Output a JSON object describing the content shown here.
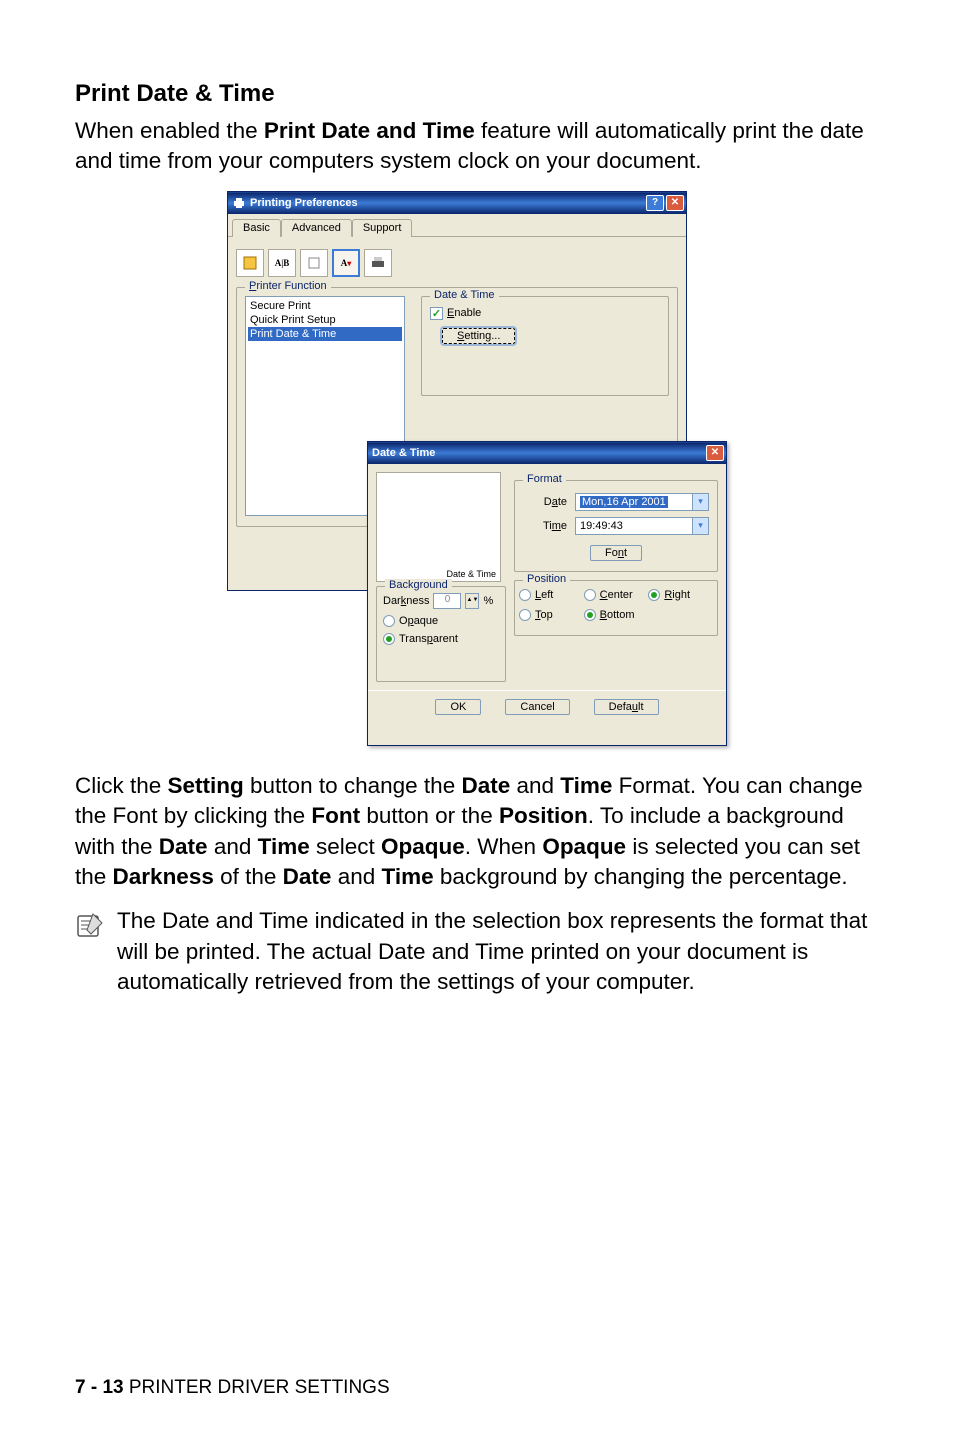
{
  "doc": {
    "heading": "Print Date & Time",
    "intro_parts": [
      "When enabled the ",
      "Print Date and Time",
      " feature will automatically print the date and time from your computers system clock on your document."
    ],
    "para2_runs": [
      {
        "t": "Click the "
      },
      {
        "t": "Setting",
        "b": true
      },
      {
        "t": " button to change the "
      },
      {
        "t": "Date",
        "b": true
      },
      {
        "t": " and "
      },
      {
        "t": "Time",
        "b": true
      },
      {
        "t": " Format. You can change the Font by clicking the "
      },
      {
        "t": "Font",
        "b": true
      },
      {
        "t": " button or the "
      },
      {
        "t": "Position",
        "b": true
      },
      {
        "t": ". To include a background with the "
      },
      {
        "t": "Date",
        "b": true
      },
      {
        "t": " and "
      },
      {
        "t": "Time",
        "b": true
      },
      {
        "t": " select "
      },
      {
        "t": "Opaque",
        "b": true
      },
      {
        "t": ". When "
      },
      {
        "t": "Opaque",
        "b": true
      },
      {
        "t": " is selected you can set the "
      },
      {
        "t": "Darkness",
        "b": true
      },
      {
        "t": " of the "
      },
      {
        "t": "Date",
        "b": true
      },
      {
        "t": " and "
      },
      {
        "t": "Time",
        "b": true
      },
      {
        "t": " background by changing the percentage."
      }
    ],
    "note": "The Date and Time indicated in the selection box represents the format that will be printed. The actual Date and Time printed on your document is automatically retrieved from the settings of your computer.",
    "footer_page": "7 - 13",
    "footer_title": "   PRINTER DRIVER SETTINGS"
  },
  "win": {
    "title": "Printing Preferences",
    "tabs": {
      "basic": "Basic",
      "advanced": "Advanced",
      "support": "Support"
    },
    "groupbox_title": "Printer Function",
    "func_items": [
      "Secure Print",
      "Quick Print Setup",
      "Print Date & Time"
    ],
    "func_selected_index": 2,
    "dt_group_title": "Date & Time",
    "enable_text": "Enable",
    "setting_btn": "Setting..."
  },
  "sub": {
    "title": "Date & Time",
    "preview_label": "Date & Time",
    "bg_group_title": "Background",
    "darkness_label": "Darkness",
    "darkness_value": "0",
    "darkness_unit": "%",
    "opaque_label": "Opaque",
    "transparent_label": "Transparent",
    "format_group_title": "Format",
    "date_label": "Date",
    "date_value": "Mon,16 Apr 2001",
    "time_label": "Time",
    "time_value": "19:49:43",
    "font_btn": "Font",
    "position_group_title": "Position",
    "pos_left": "Left",
    "pos_center": "Center",
    "pos_right": "Right",
    "pos_top": "Top",
    "pos_bottom": "Bottom",
    "ok": "OK",
    "cancel": "Cancel",
    "default": "Default"
  }
}
